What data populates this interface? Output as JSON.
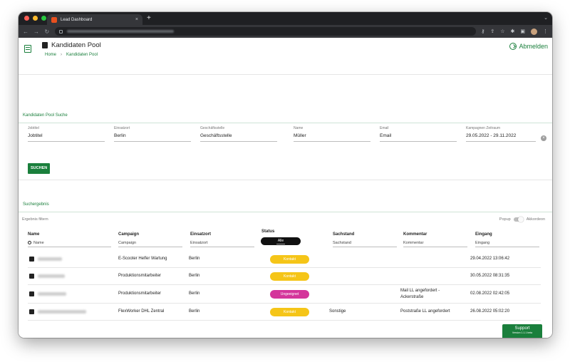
{
  "browser": {
    "tab_title": "Lead Dashboard",
    "tab_close": "×",
    "new_tab": "+",
    "tab_menu": "⌄"
  },
  "header": {
    "title": "Kandidaten Pool",
    "breadcrumb": [
      "Home",
      "›",
      "Kandidaten Pool"
    ],
    "logout_label": "Abmelden"
  },
  "search_section": {
    "title": "Kandidaten Pool Suche",
    "filters": [
      {
        "label": "Jobtitel",
        "value": "Jobtitel"
      },
      {
        "label": "Einsatzort",
        "value": "Berlin"
      },
      {
        "label": "Geschäftsstelle",
        "value": "Geschäftsstelle"
      },
      {
        "label": "Name",
        "value": "Müller"
      },
      {
        "label": "Email",
        "value": "Email"
      },
      {
        "label": "Kampagnen Zeitraum",
        "value": "29.05.2022 - 29.11.2022"
      }
    ],
    "search_button": "SUCHEN",
    "clear_icon": "×"
  },
  "results_section": {
    "title": "Suchergebnis",
    "filter_rows_label": "Ergebnis filtern",
    "toggle_left": "Popup",
    "toggle_right": "Akkordeon"
  },
  "table": {
    "headers": {
      "name": "Name",
      "campaign": "Campaign",
      "einsatzort": "Einsatzort",
      "status": "Status",
      "sachstand": "Sachstand",
      "kommentar": "Kommentar",
      "eingang": "Eingang"
    },
    "filters": {
      "name": "Name",
      "campaign": "Campaign",
      "einsatzort": "Einsatzort",
      "status": "Alle",
      "sachstand": "Sachstand",
      "kommentar": "Kommentar",
      "eingang": "Eingang"
    },
    "rows": [
      {
        "campaign": "E-Scooter Helfer Wartung",
        "einsatzort": "Berlin",
        "status": "Kontakt",
        "status_color": "#f5c518",
        "sachstand": "",
        "kommentar": "",
        "eingang": "29.04.2022 13:06:42"
      },
      {
        "campaign": "Produktionsmitarbeiter",
        "einsatzort": "Berlin",
        "status": "Kontakt",
        "status_color": "#f5c518",
        "sachstand": "",
        "kommentar": "",
        "eingang": "30.05.2022 08:31:35"
      },
      {
        "campaign": "Produktionsmitarbeiter",
        "einsatzort": "Berlin",
        "status": "Ungeeignet",
        "status_color": "#d4359b",
        "sachstand": "",
        "kommentar": "Mail LL angefordert - Ackerstraße",
        "eingang": "02.08.2022 02:42:05"
      },
      {
        "campaign": "FlexWorker DHL Zentral",
        "einsatzort": "Berlin",
        "status": "Kontakt",
        "status_color": "#f5c518",
        "sachstand": "Sonstige",
        "kommentar": "Poststraße LL angefordert",
        "eingang": "26.08.2022 05:02:20"
      }
    ]
  },
  "support": {
    "label": "Support",
    "version": "Version 1.1.1 beta"
  }
}
